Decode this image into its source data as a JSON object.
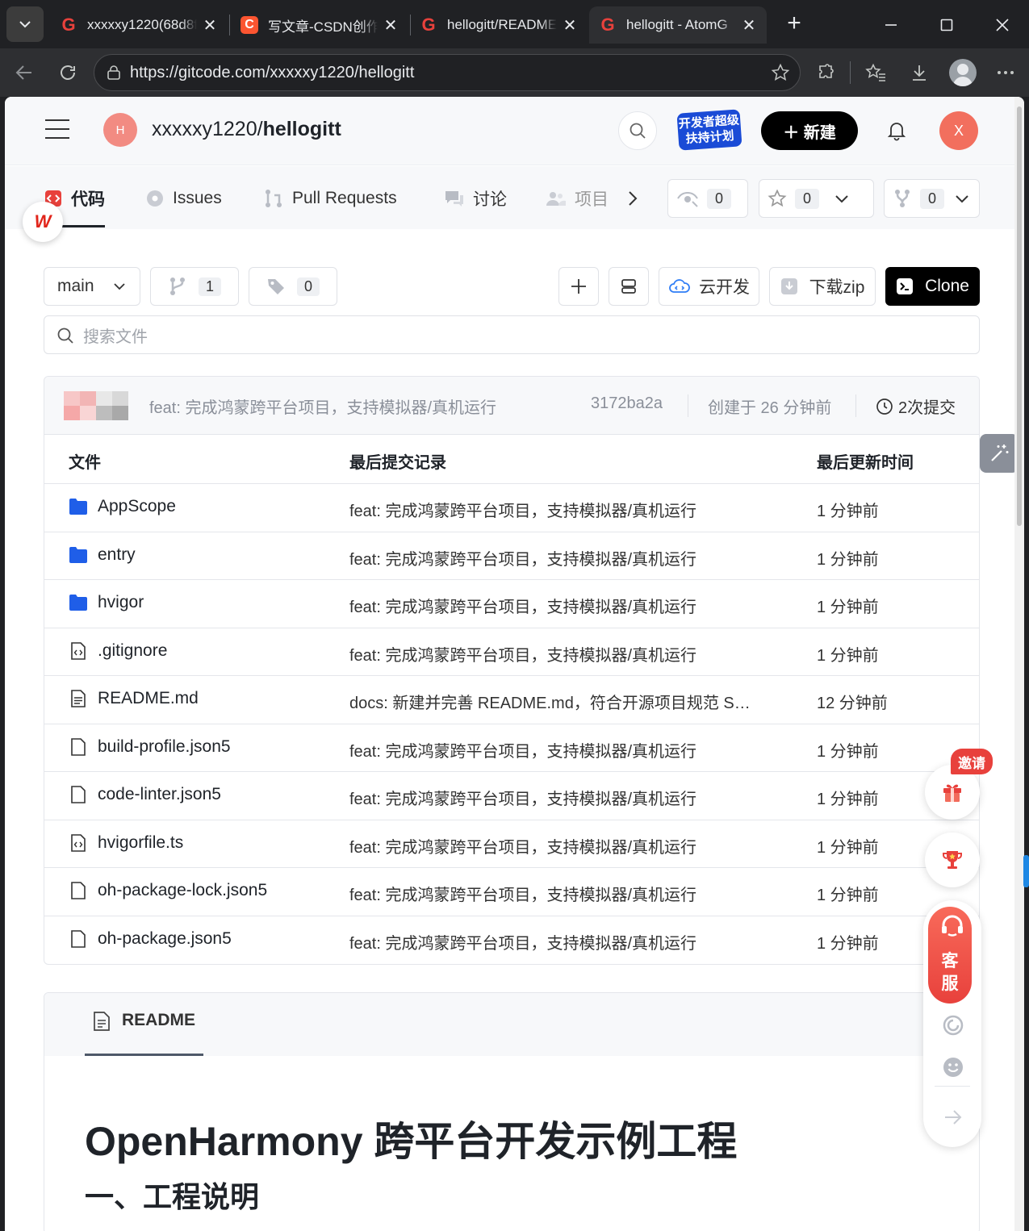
{
  "browser": {
    "tabs": [
      {
        "label": "xxxxxy1220(68d8f",
        "favicon": "G",
        "active": false
      },
      {
        "label": "写文章-CSDN创作",
        "favicon": "C",
        "active": false
      },
      {
        "label": "hellogitt/README",
        "favicon": "G",
        "active": false
      },
      {
        "label": "hellogitt - AtomG",
        "favicon": "G",
        "active": true
      }
    ],
    "close_glyph": "✕",
    "new_tab_glyph": "+",
    "url": "https://gitcode.com/xxxxxy1220/hellogitt"
  },
  "header": {
    "repo_avatar": "H",
    "repo_owner": "xxxxxy1220/",
    "repo_name": "hellogitt",
    "promo_line1": "开发者超级",
    "promo_line2": "扶持计划",
    "new_button": "＋ 新建",
    "user_avatar": "X"
  },
  "navtabs": {
    "code": "代码",
    "issues": "Issues",
    "pull_requests": "Pull Requests",
    "discussions": "讨论",
    "projects": "项目",
    "watch_count": "0",
    "star_count": "0",
    "fork_count": "0"
  },
  "toolbar": {
    "branch": "main",
    "branch_count": "1",
    "tag_count": "0",
    "cloud_dev": "云开发",
    "download_zip": "下载zip",
    "clone": "Clone",
    "search_placeholder": "搜索文件"
  },
  "commit": {
    "message": "feat: 完成鸿蒙跨平台项目，支持模拟器/真机运行",
    "hash": "3172ba2a",
    "created": "创建于 26 分钟前",
    "count": "2次提交"
  },
  "file_table": {
    "headers": {
      "file": "文件",
      "last_commit": "最后提交记录",
      "last_update": "最后更新时间"
    },
    "rows": [
      {
        "name": "AppScope",
        "type": "folder",
        "commit": "feat: 完成鸿蒙跨平台项目，支持模拟器/真机运行",
        "time": "1 分钟前"
      },
      {
        "name": "entry",
        "type": "folder",
        "commit": "feat: 完成鸿蒙跨平台项目，支持模拟器/真机运行",
        "time": "1 分钟前"
      },
      {
        "name": "hvigor",
        "type": "folder",
        "commit": "feat: 完成鸿蒙跨平台项目，支持模拟器/真机运行",
        "time": "1 分钟前"
      },
      {
        "name": ".gitignore",
        "type": "code",
        "commit": "feat: 完成鸿蒙跨平台项目，支持模拟器/真机运行",
        "time": "1 分钟前"
      },
      {
        "name": "README.md",
        "type": "doc",
        "commit": "docs: 新建并完善 README.md，符合开源项目规范 S…",
        "time": "12 分钟前"
      },
      {
        "name": "build-profile.json5",
        "type": "file",
        "commit": "feat: 完成鸿蒙跨平台项目，支持模拟器/真机运行",
        "time": "1 分钟前"
      },
      {
        "name": "code-linter.json5",
        "type": "file",
        "commit": "feat: 完成鸿蒙跨平台项目，支持模拟器/真机运行",
        "time": "1 分钟前"
      },
      {
        "name": "hvigorfile.ts",
        "type": "code",
        "commit": "feat: 完成鸿蒙跨平台项目，支持模拟器/真机运行",
        "time": "1 分钟前"
      },
      {
        "name": "oh-package-lock.json5",
        "type": "file",
        "commit": "feat: 完成鸿蒙跨平台项目，支持模拟器/真机运行",
        "time": "1 分钟前"
      },
      {
        "name": "oh-package.json5",
        "type": "file",
        "commit": "feat: 完成鸿蒙跨平台项目，支持模拟器/真机运行",
        "time": "1 分钟前"
      }
    ]
  },
  "readme": {
    "tab": "README",
    "h1": "OpenHarmony 跨平台开发示例工程",
    "h2": "一、工程说明"
  },
  "float": {
    "invite": "邀请",
    "service_line1": "客",
    "service_line2": "服"
  },
  "colors": {
    "accent_red": "#e8413c",
    "folder_blue": "#1f5ee8",
    "dark_button": "#000000"
  }
}
